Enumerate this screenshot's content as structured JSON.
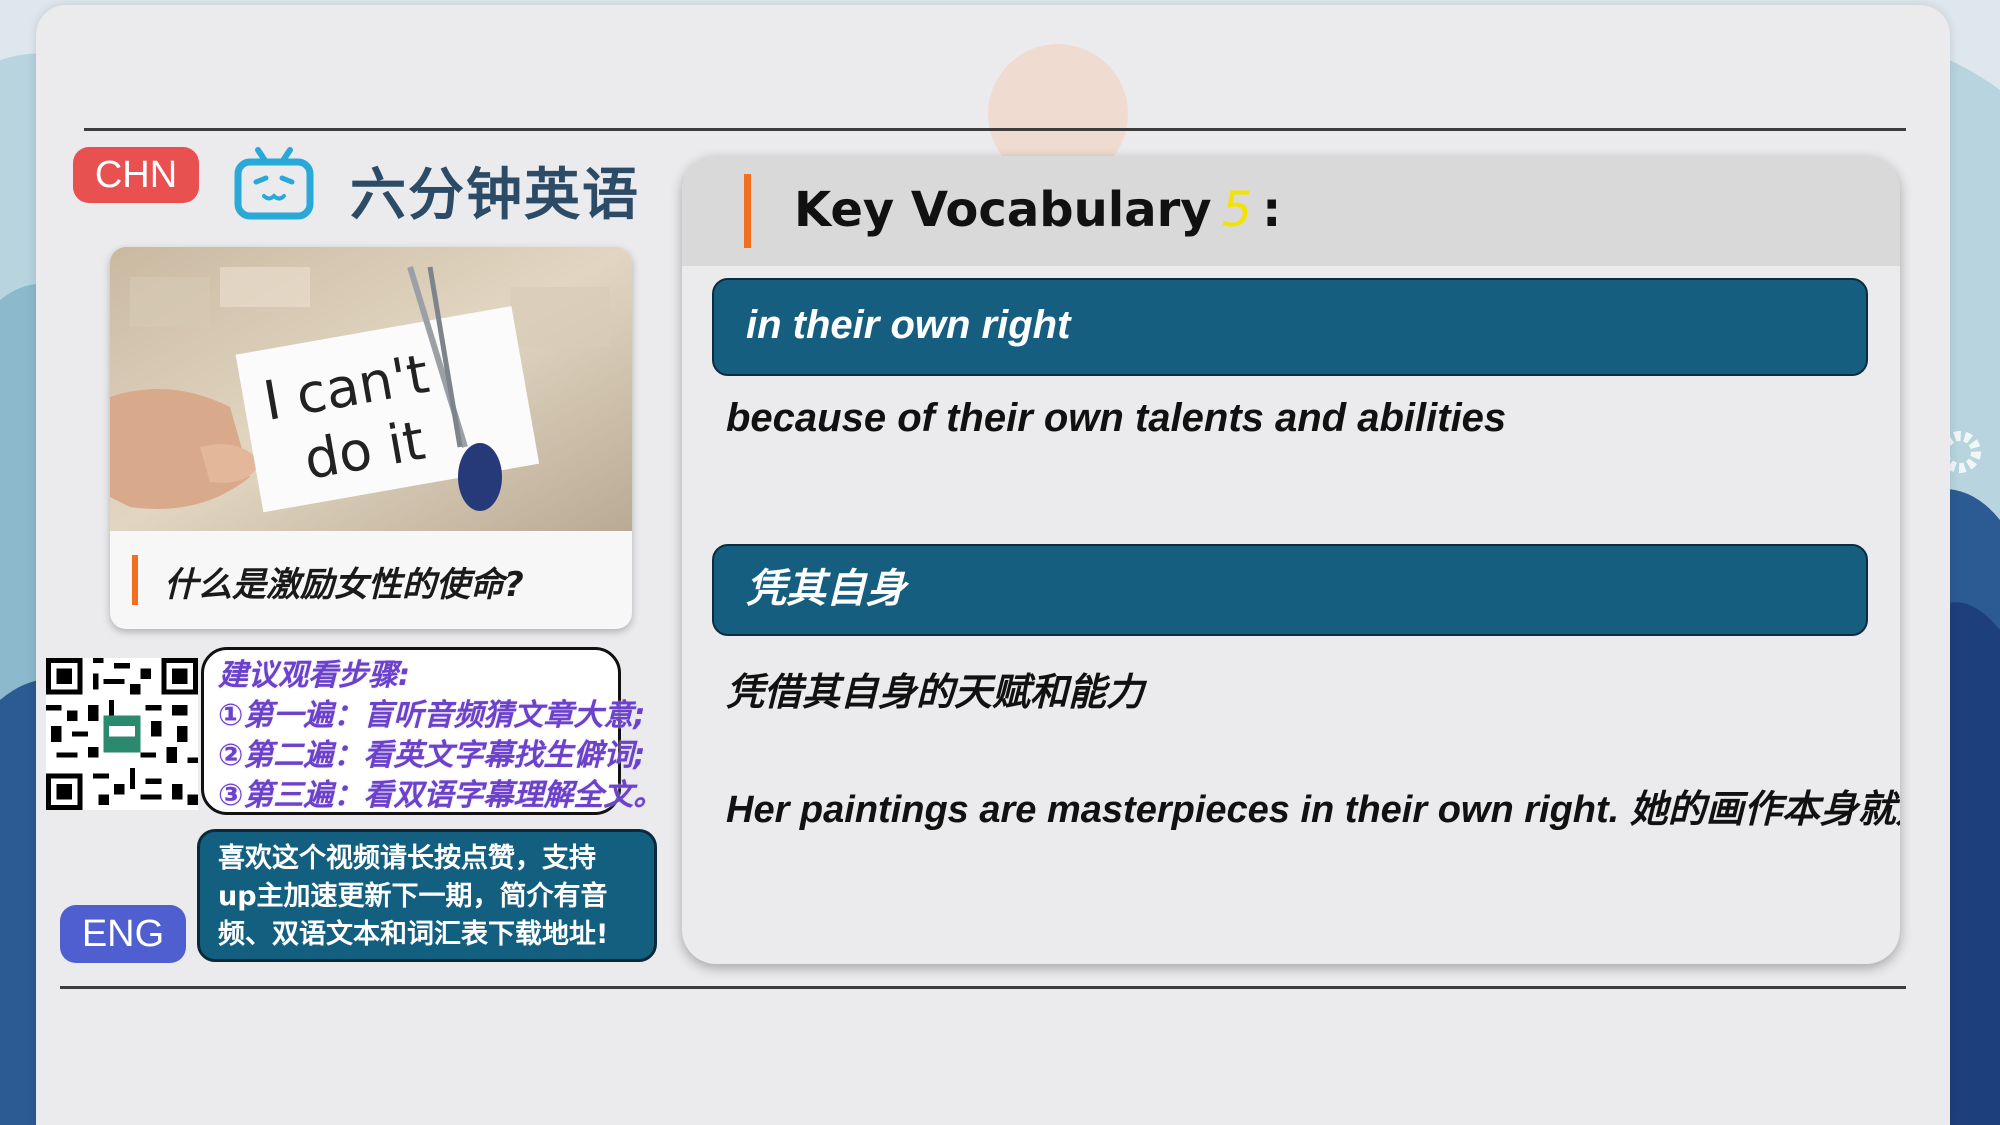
{
  "badges": {
    "chn": "CHN",
    "eng": "ENG"
  },
  "brand": {
    "title": "六分钟英语"
  },
  "card": {
    "caption": "什么是激励女性的使命?",
    "image_text_1": "I can't",
    "image_text_2": "do it"
  },
  "steps": {
    "line1": "建议观看步骤:",
    "line2": "①第一遍：盲听音频猜文章大意;",
    "line3": "②第二遍：看英文字幕找生僻词;",
    "line4": "③第三遍：看双语字幕理解全文。"
  },
  "like": {
    "line1": "喜欢这个视频请长按点赞，支持",
    "line2": "up主加速更新下一期，简介有音",
    "line3": "频、双语文本和词汇表下载地址!"
  },
  "vocab": {
    "heading": "Key Vocabulary",
    "number": "5",
    "colon": ":",
    "phrase": "in their own right",
    "definition": "because of their own talents and abilities",
    "phrase_cn": "凭其自身",
    "definition_cn": "凭借其自身的天赋和能力",
    "example": "Her paintings are masterpieces in their own right. 她的画作本身就是杰作。"
  },
  "colors": {
    "accent": "#f07020",
    "bar": "#165e80",
    "chn": "#e8514f",
    "eng": "#4f5fcf"
  },
  "icons": [
    "bilibili-tv-icon",
    "qr-code-icon",
    "gear-icon"
  ]
}
